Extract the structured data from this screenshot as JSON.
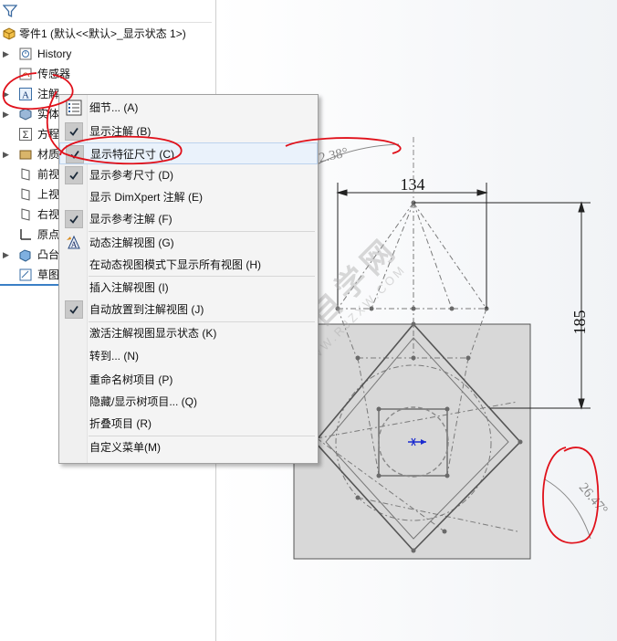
{
  "tree": {
    "root_label": "零件1  (默认<<默认>_显示状态 1>)",
    "items": [
      {
        "label": "History",
        "icon": "history-icon"
      },
      {
        "label": "传感器",
        "icon": "sensor-icon"
      },
      {
        "label": "注解",
        "icon": "annotation-icon"
      },
      {
        "label": "实体",
        "icon": "solid-body-icon"
      },
      {
        "label": "方程",
        "icon": "equation-icon"
      },
      {
        "label": "材质",
        "icon": "material-icon"
      },
      {
        "label": "前视",
        "icon": "plane-icon"
      },
      {
        "label": "上视",
        "icon": "plane-icon"
      },
      {
        "label": "右视",
        "icon": "plane-icon"
      },
      {
        "label": "原点",
        "icon": "origin-icon"
      },
      {
        "label": "凸台",
        "icon": "boss-extrude-icon"
      },
      {
        "label": "草图",
        "icon": "sketch-icon"
      }
    ]
  },
  "menu": {
    "items": [
      {
        "label": "细节... (A)",
        "checked": false,
        "icon": "details-icon"
      },
      {
        "label": "显示注解 (B)",
        "checked": true
      },
      {
        "label": "显示特征尺寸 (C)",
        "checked": true,
        "hover": true
      },
      {
        "label": "显示参考尺寸 (D)",
        "checked": true
      },
      {
        "label": "显示 DimXpert 注解 (E)",
        "checked": false
      },
      {
        "label": "显示参考注解 (F)",
        "checked": true
      },
      {
        "label": "动态注解视图 (G)",
        "checked": false,
        "icon": "dynamic-annotation-icon"
      },
      {
        "label": "在动态视图模式下显示所有视图 (H)",
        "checked": false
      },
      {
        "label": "插入注解视图 (I)",
        "checked": false
      },
      {
        "label": "自动放置到注解视图 (J)",
        "checked": true
      },
      {
        "label": "激活注解视图显示状态 (K)",
        "checked": false
      },
      {
        "label": "转到... (N)",
        "checked": false
      },
      {
        "label": "重命名树项目 (P)",
        "checked": false
      },
      {
        "label": "隐藏/显示树项目... (Q)",
        "checked": false
      },
      {
        "label": "折叠项目 (R)",
        "checked": false
      },
      {
        "label": "自定义菜单(M)",
        "checked": false
      }
    ]
  },
  "canvas": {
    "dim_width": "134",
    "dim_height": "185",
    "dim_angle_top": "2.38°",
    "dim_angle_right": "26.47°",
    "watermark": "软件自学网",
    "watermark_sub": "WWW.RJZXW.COM"
  },
  "colors": {
    "accent": "#3a7fc6",
    "annotation_red": "#e0101a",
    "part_fill": "#d9d9d9"
  }
}
